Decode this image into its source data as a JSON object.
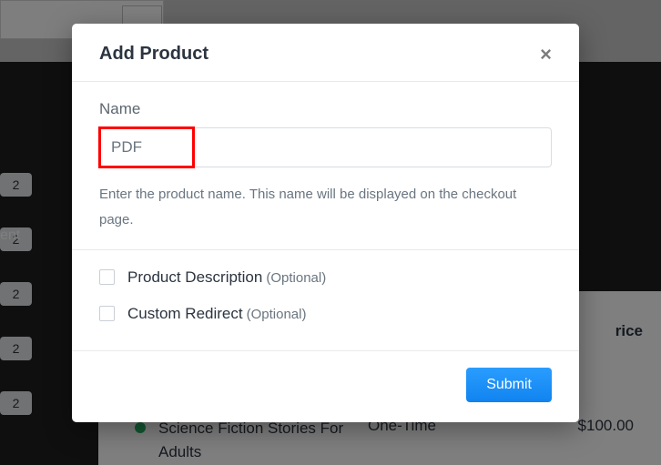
{
  "modal": {
    "title": "Add Product",
    "close_glyph": "×",
    "name": {
      "label": "Name",
      "value": "PDF",
      "helper": "Enter the product name. This name will be displayed on the checkout page."
    },
    "options": {
      "description_label": "Product Description",
      "description_optional": "(Optional)",
      "redirect_label": "Custom Redirect",
      "redirect_optional": "(Optional)"
    },
    "submit_label": "Submit"
  },
  "background": {
    "side_pills": [
      "2",
      "2",
      "2",
      "2",
      "2"
    ],
    "side_text": "ent",
    "table": {
      "header_right": "rice",
      "row": {
        "name": "Science Fiction Stories For Adults",
        "type": "One-Time",
        "price": "$100.00"
      }
    }
  }
}
